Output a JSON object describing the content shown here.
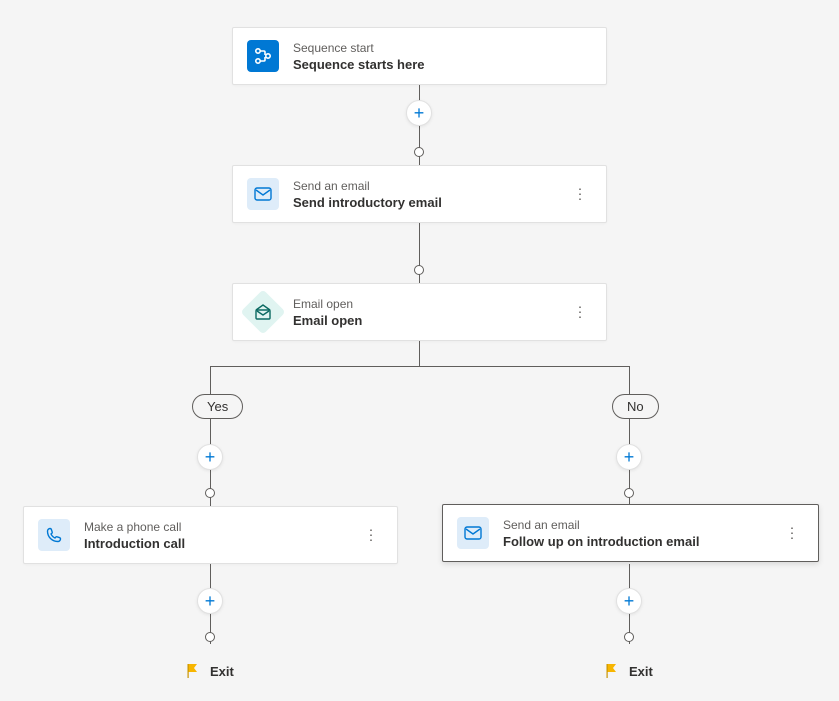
{
  "nodes": {
    "start": {
      "label": "Sequence start",
      "title": "Sequence starts here"
    },
    "email1": {
      "label": "Send an email",
      "title": "Send introductory email"
    },
    "condition": {
      "label": "Email open",
      "title": "Email open"
    },
    "call": {
      "label": "Make a phone call",
      "title": "Introduction call"
    },
    "email2": {
      "label": "Send an email",
      "title": "Follow up on introduction email"
    }
  },
  "branches": {
    "yes": "Yes",
    "no": "No"
  },
  "exit": {
    "left": "Exit",
    "right": "Exit"
  }
}
